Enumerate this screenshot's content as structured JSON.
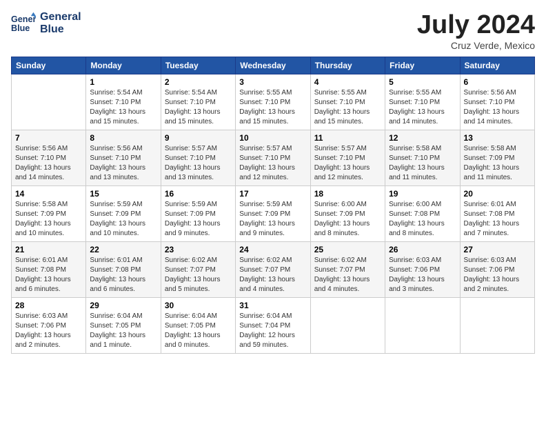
{
  "header": {
    "logo_line1": "General",
    "logo_line2": "Blue",
    "month_year": "July 2024",
    "location": "Cruz Verde, Mexico"
  },
  "weekdays": [
    "Sunday",
    "Monday",
    "Tuesday",
    "Wednesday",
    "Thursday",
    "Friday",
    "Saturday"
  ],
  "weeks": [
    [
      {
        "day": "",
        "info": ""
      },
      {
        "day": "1",
        "info": "Sunrise: 5:54 AM\nSunset: 7:10 PM\nDaylight: 13 hours\nand 15 minutes."
      },
      {
        "day": "2",
        "info": "Sunrise: 5:54 AM\nSunset: 7:10 PM\nDaylight: 13 hours\nand 15 minutes."
      },
      {
        "day": "3",
        "info": "Sunrise: 5:55 AM\nSunset: 7:10 PM\nDaylight: 13 hours\nand 15 minutes."
      },
      {
        "day": "4",
        "info": "Sunrise: 5:55 AM\nSunset: 7:10 PM\nDaylight: 13 hours\nand 15 minutes."
      },
      {
        "day": "5",
        "info": "Sunrise: 5:55 AM\nSunset: 7:10 PM\nDaylight: 13 hours\nand 14 minutes."
      },
      {
        "day": "6",
        "info": "Sunrise: 5:56 AM\nSunset: 7:10 PM\nDaylight: 13 hours\nand 14 minutes."
      }
    ],
    [
      {
        "day": "7",
        "info": "Sunrise: 5:56 AM\nSunset: 7:10 PM\nDaylight: 13 hours\nand 14 minutes."
      },
      {
        "day": "8",
        "info": "Sunrise: 5:56 AM\nSunset: 7:10 PM\nDaylight: 13 hours\nand 13 minutes."
      },
      {
        "day": "9",
        "info": "Sunrise: 5:57 AM\nSunset: 7:10 PM\nDaylight: 13 hours\nand 13 minutes."
      },
      {
        "day": "10",
        "info": "Sunrise: 5:57 AM\nSunset: 7:10 PM\nDaylight: 13 hours\nand 12 minutes."
      },
      {
        "day": "11",
        "info": "Sunrise: 5:57 AM\nSunset: 7:10 PM\nDaylight: 13 hours\nand 12 minutes."
      },
      {
        "day": "12",
        "info": "Sunrise: 5:58 AM\nSunset: 7:10 PM\nDaylight: 13 hours\nand 11 minutes."
      },
      {
        "day": "13",
        "info": "Sunrise: 5:58 AM\nSunset: 7:09 PM\nDaylight: 13 hours\nand 11 minutes."
      }
    ],
    [
      {
        "day": "14",
        "info": "Sunrise: 5:58 AM\nSunset: 7:09 PM\nDaylight: 13 hours\nand 10 minutes."
      },
      {
        "day": "15",
        "info": "Sunrise: 5:59 AM\nSunset: 7:09 PM\nDaylight: 13 hours\nand 10 minutes."
      },
      {
        "day": "16",
        "info": "Sunrise: 5:59 AM\nSunset: 7:09 PM\nDaylight: 13 hours\nand 9 minutes."
      },
      {
        "day": "17",
        "info": "Sunrise: 5:59 AM\nSunset: 7:09 PM\nDaylight: 13 hours\nand 9 minutes."
      },
      {
        "day": "18",
        "info": "Sunrise: 6:00 AM\nSunset: 7:09 PM\nDaylight: 13 hours\nand 8 minutes."
      },
      {
        "day": "19",
        "info": "Sunrise: 6:00 AM\nSunset: 7:08 PM\nDaylight: 13 hours\nand 8 minutes."
      },
      {
        "day": "20",
        "info": "Sunrise: 6:01 AM\nSunset: 7:08 PM\nDaylight: 13 hours\nand 7 minutes."
      }
    ],
    [
      {
        "day": "21",
        "info": "Sunrise: 6:01 AM\nSunset: 7:08 PM\nDaylight: 13 hours\nand 6 minutes."
      },
      {
        "day": "22",
        "info": "Sunrise: 6:01 AM\nSunset: 7:08 PM\nDaylight: 13 hours\nand 6 minutes."
      },
      {
        "day": "23",
        "info": "Sunrise: 6:02 AM\nSunset: 7:07 PM\nDaylight: 13 hours\nand 5 minutes."
      },
      {
        "day": "24",
        "info": "Sunrise: 6:02 AM\nSunset: 7:07 PM\nDaylight: 13 hours\nand 4 minutes."
      },
      {
        "day": "25",
        "info": "Sunrise: 6:02 AM\nSunset: 7:07 PM\nDaylight: 13 hours\nand 4 minutes."
      },
      {
        "day": "26",
        "info": "Sunrise: 6:03 AM\nSunset: 7:06 PM\nDaylight: 13 hours\nand 3 minutes."
      },
      {
        "day": "27",
        "info": "Sunrise: 6:03 AM\nSunset: 7:06 PM\nDaylight: 13 hours\nand 2 minutes."
      }
    ],
    [
      {
        "day": "28",
        "info": "Sunrise: 6:03 AM\nSunset: 7:06 PM\nDaylight: 13 hours\nand 2 minutes."
      },
      {
        "day": "29",
        "info": "Sunrise: 6:04 AM\nSunset: 7:05 PM\nDaylight: 13 hours\nand 1 minute."
      },
      {
        "day": "30",
        "info": "Sunrise: 6:04 AM\nSunset: 7:05 PM\nDaylight: 13 hours\nand 0 minutes."
      },
      {
        "day": "31",
        "info": "Sunrise: 6:04 AM\nSunset: 7:04 PM\nDaylight: 12 hours\nand 59 minutes."
      },
      {
        "day": "",
        "info": ""
      },
      {
        "day": "",
        "info": ""
      },
      {
        "day": "",
        "info": ""
      }
    ]
  ]
}
